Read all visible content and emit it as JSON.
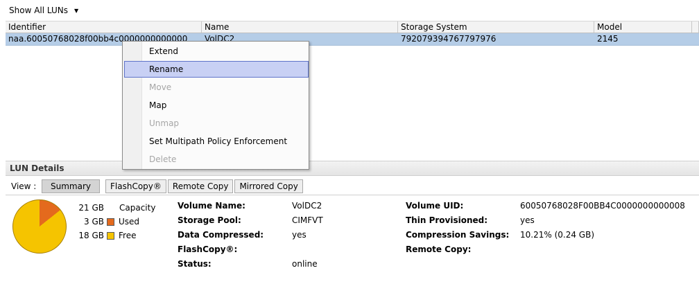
{
  "filter": {
    "label": "Show All LUNs"
  },
  "table": {
    "columns": [
      "Identifier",
      "Name",
      "Storage System",
      "Model"
    ],
    "rows": [
      {
        "identifier": "naa.60050768028f00bb4c0000000000000",
        "name": "VolDC2",
        "storage_system": "792079394767797976",
        "model": "2145"
      }
    ]
  },
  "context_menu": {
    "items": [
      {
        "label": "Extend",
        "state": "enabled"
      },
      {
        "label": "Rename",
        "state": "hovered"
      },
      {
        "label": "Move",
        "state": "disabled"
      },
      {
        "label": "Map",
        "state": "enabled"
      },
      {
        "label": "Unmap",
        "state": "disabled"
      },
      {
        "label": "Set Multipath Policy Enforcement",
        "state": "enabled"
      },
      {
        "label": "Delete",
        "state": "disabled"
      }
    ]
  },
  "details": {
    "title": "LUN Details",
    "view_label": "View :",
    "tabs": [
      "Summary",
      "FlashCopy®",
      "Remote Copy",
      "Mirrored Copy"
    ],
    "active_tab": "Summary",
    "capacity": {
      "total": "21 GB",
      "total_label": "Capacity",
      "used": "3 GB",
      "used_label": "Used",
      "free": "18 GB",
      "free_label": "Free",
      "used_fraction": 0.143,
      "colors": {
        "used": "#e46a1d",
        "free": "#f5c400"
      }
    },
    "fields": [
      {
        "label": "Volume Name:",
        "value": "VolDC2"
      },
      {
        "label": "Storage Pool:",
        "value": "CIMFVT"
      },
      {
        "label": "Data Compressed:",
        "value": "yes"
      },
      {
        "label": "FlashCopy®:",
        "value": ""
      },
      {
        "label": "Status:",
        "value": "online"
      },
      {
        "label": "Volume UID:",
        "value": "60050768028F00BB4C0000000000008"
      },
      {
        "label": "Thin Provisioned:",
        "value": "yes"
      },
      {
        "label": "Compression Savings:",
        "value": "10.21% (0.24 GB)"
      },
      {
        "label": "Remote Copy:",
        "value": ""
      }
    ]
  },
  "colors": {
    "selection": "#b5cde7",
    "menu_hover": "#c8d0f4"
  }
}
